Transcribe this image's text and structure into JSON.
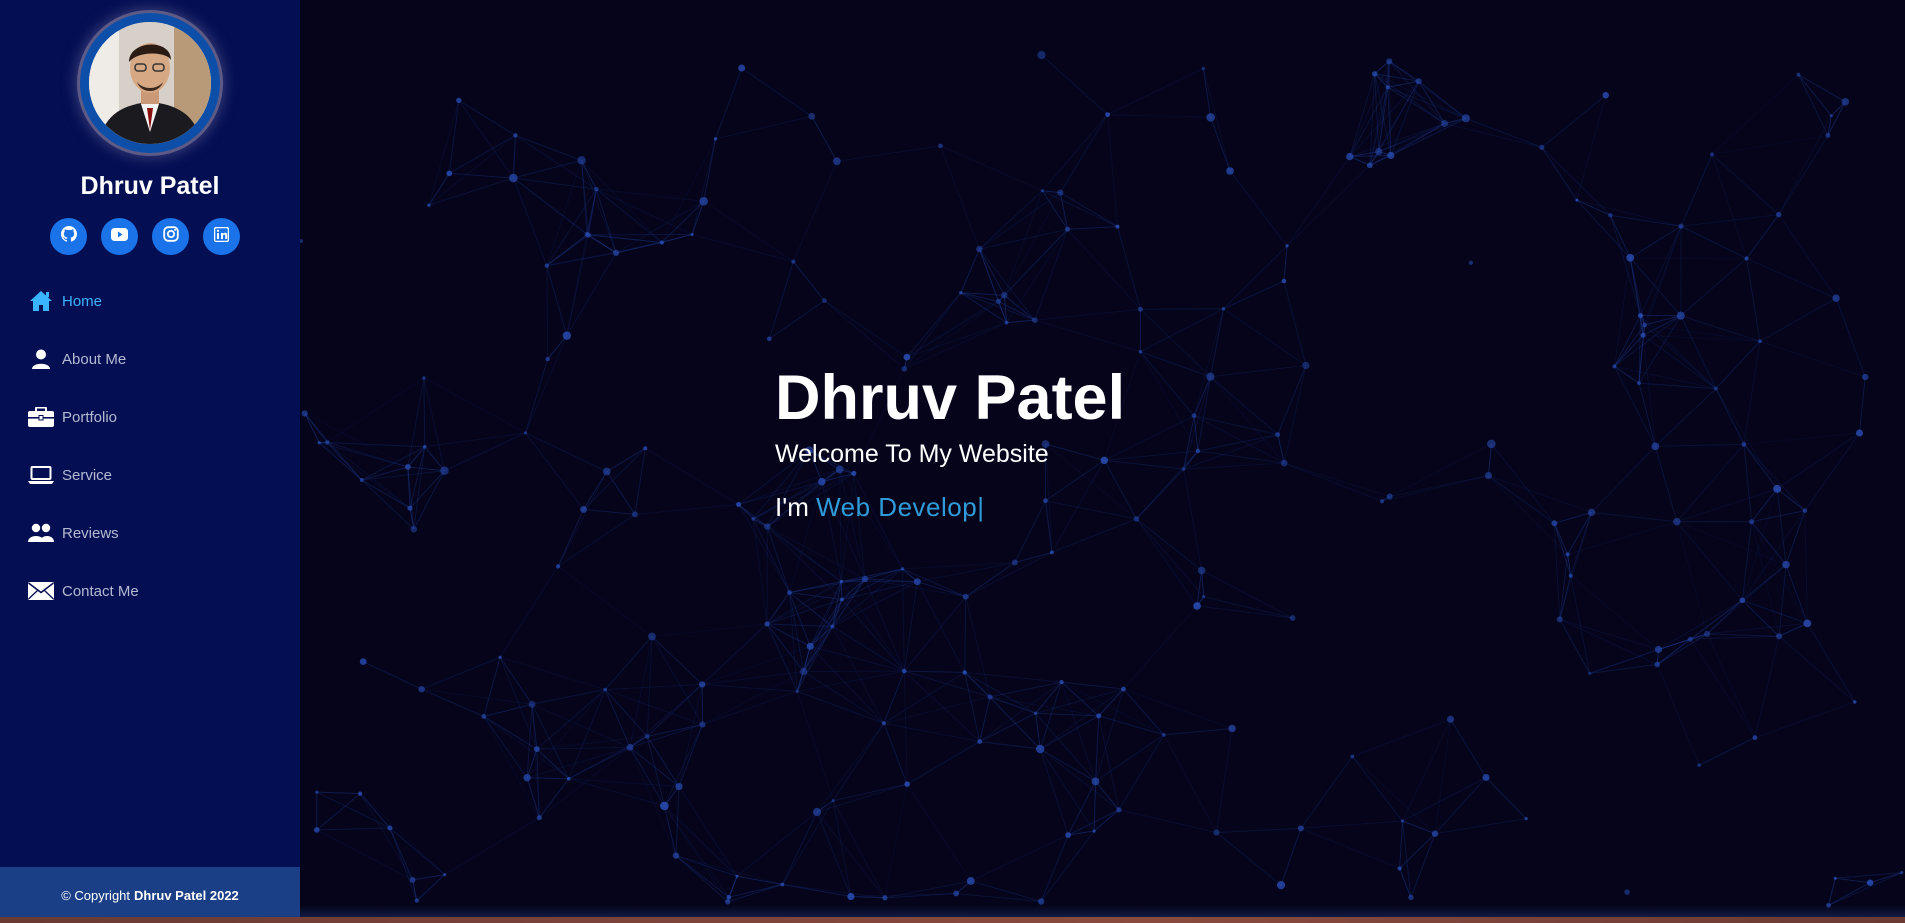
{
  "profile": {
    "name": "Dhruv Patel",
    "avatar_icon": "profile-photo"
  },
  "socials": [
    {
      "icon": "github-icon",
      "label": "GitHub"
    },
    {
      "icon": "youtube-icon",
      "label": "YouTube"
    },
    {
      "icon": "instagram-icon",
      "label": "Instagram"
    },
    {
      "icon": "linkedin-icon",
      "label": "LinkedIn"
    }
  ],
  "nav": {
    "items": [
      {
        "label": "Home",
        "icon": "home-icon",
        "active": true
      },
      {
        "label": "About Me",
        "icon": "user-icon",
        "active": false
      },
      {
        "label": "Portfolio",
        "icon": "briefcase-icon",
        "active": false
      },
      {
        "label": "Service",
        "icon": "laptop-icon",
        "active": false
      },
      {
        "label": "Reviews",
        "icon": "users-icon",
        "active": false
      },
      {
        "label": "Contact Me",
        "icon": "envelope-icon",
        "active": false
      }
    ]
  },
  "footer": {
    "copyright": "© Copyright",
    "owner": "Dhruv Patel 2022"
  },
  "hero": {
    "name": "Dhruv Patel",
    "welcome": "Welcome To My Website",
    "prefix": "I'm",
    "typed": "Web Develop",
    "cursor": "|"
  },
  "colors": {
    "sidebar_bg": "#040f53",
    "main_bg": "#05041a",
    "accent": "#3bb4ff",
    "typed_text": "#2f9bd8",
    "social_button": "#1a73e8",
    "footer_bg": "#1b3f86"
  }
}
